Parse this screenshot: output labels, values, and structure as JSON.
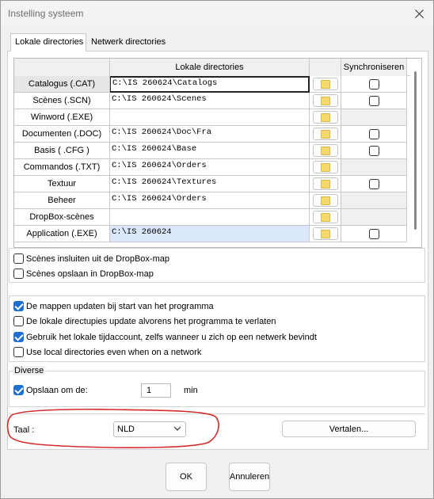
{
  "window": {
    "title": "Instelling systeem"
  },
  "tabs": [
    {
      "label": "Lokale directories"
    },
    {
      "label": "Netwerk directories"
    }
  ],
  "grid": {
    "headers": {
      "label_col": "",
      "path_col": "Lokale directories",
      "folder_col": "",
      "sync_col": "Synchroniseren"
    },
    "rows": [
      {
        "label": "Catalogus (.CAT)",
        "path": "C:\\IS 260624\\Catalogs",
        "sync": true
      },
      {
        "label": "Scènes (.SCN)",
        "path": "C:\\IS 260624\\Scenes",
        "sync": true
      },
      {
        "label": "Winword (.EXE)",
        "path": "",
        "sync": false
      },
      {
        "label": "Documenten (.DOC)",
        "path": "C:\\IS 260624\\Doc\\Fra",
        "sync": true
      },
      {
        "label": "Basis ( .CFG )",
        "path": "C:\\IS 260624\\Base",
        "sync": true
      },
      {
        "label": "Commandos (.TXT)",
        "path": "C:\\IS 260624\\Orders",
        "sync": false
      },
      {
        "label": "Textuur",
        "path": "C:\\IS 260624\\Textures",
        "sync": true
      },
      {
        "label": "Beheer",
        "path": "C:\\IS 260624\\Orders",
        "sync": false
      },
      {
        "label": "DropBox-scènes",
        "path": "",
        "sync": false
      },
      {
        "label": "Application (.EXE)",
        "path": "C:\\IS 260624",
        "sync": true
      }
    ]
  },
  "dropbox_options": [
    {
      "label": "Scènes insluiten uit de DropBox-map",
      "checked": false
    },
    {
      "label": "Scènes opslaan in DropBox-map",
      "checked": false
    }
  ],
  "general_options": [
    {
      "label": "De mappen updaten bij start van het programma",
      "checked": true
    },
    {
      "label": "De lokale directupies update alvorens het programma te verlaten",
      "checked": false
    },
    {
      "label": "Gebruik het lokale tijdaccount, zelfs wanneer u zich op een netwerk bevindt",
      "checked": true
    },
    {
      "label": "Use local directories even when on a network",
      "checked": false
    }
  ],
  "diverse": {
    "group_label": "Diverse",
    "save_label": "Opslaan om de:",
    "save_checked": true,
    "save_value": "1",
    "unit": "min"
  },
  "language": {
    "label": "Taal :",
    "selected": "NLD",
    "translate_button": "Vertalen..."
  },
  "buttons": {
    "ok": "OK",
    "cancel": "Annuleren"
  },
  "colors": {
    "accent": "#1f6fd0",
    "annotation": "#d42a2a"
  }
}
